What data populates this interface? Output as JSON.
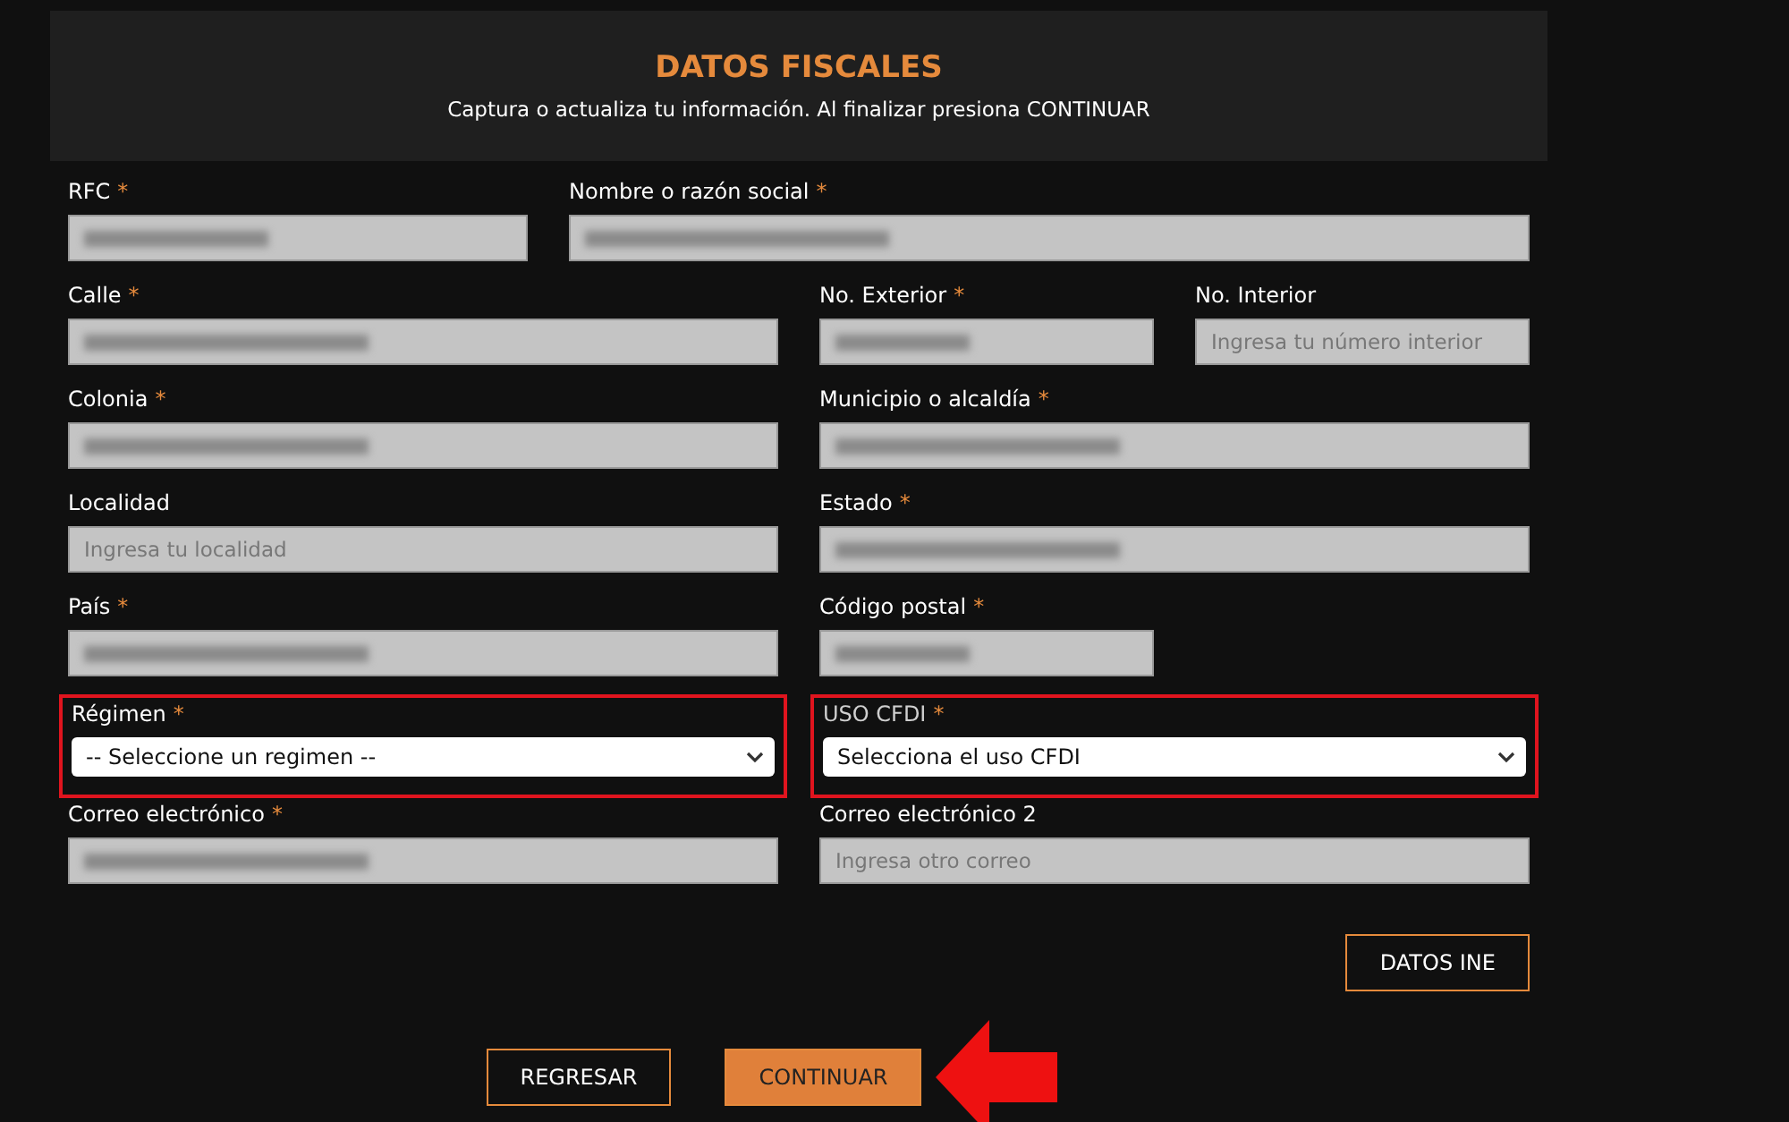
{
  "header": {
    "title": "DATOS FISCALES",
    "subtitle": "Captura o actualiza tu información. Al finalizar presiona CONTINUAR"
  },
  "rows": [
    [
      {
        "kind": "input",
        "label": "RFC",
        "required_mark": "*",
        "redacted": true
      },
      {
        "kind": "input",
        "label": "Nombre o razón social",
        "required_mark": "*",
        "redacted": true
      }
    ],
    [
      {
        "kind": "input",
        "label": "Calle",
        "required_mark": "*",
        "redacted": true
      },
      {
        "kind": "input",
        "label": "No. Exterior",
        "required_mark": "*",
        "redacted": true
      },
      {
        "kind": "input",
        "label": "No. Interior",
        "placeholder": "Ingresa tu número interior"
      }
    ],
    [
      {
        "kind": "input",
        "label": "Colonia",
        "required_mark": "*",
        "redacted": true
      },
      {
        "kind": "input",
        "label": "Municipio o alcaldía",
        "required_mark": "*",
        "redacted": true
      }
    ],
    [
      {
        "kind": "input",
        "label": "Localidad",
        "placeholder": "Ingresa tu localidad"
      },
      {
        "kind": "input",
        "label": "Estado",
        "required_mark": "*",
        "redacted": true
      }
    ],
    [
      {
        "kind": "input",
        "label": "País",
        "required_mark": "*",
        "redacted": true
      },
      {
        "kind": "input",
        "label": "Código postal",
        "required_mark": "*",
        "redacted": true
      }
    ],
    [
      {
        "kind": "select",
        "label": "Régimen",
        "required_mark": "*",
        "value": "-- Seleccione un regimen --",
        "highlighted": true
      },
      {
        "kind": "select",
        "label": "USO CFDI",
        "required_mark": "*",
        "value": "Selecciona el uso CFDI",
        "highlighted": true
      }
    ],
    [
      {
        "kind": "input",
        "label": "Correo electrónico",
        "required_mark": "*",
        "redacted": true
      },
      {
        "kind": "input",
        "label": "Correo electrónico 2",
        "placeholder": "Ingresa otro correo"
      }
    ]
  ],
  "side_button": "DATOS INE",
  "buttons": [
    {
      "label": "REGRESAR",
      "primary": false
    },
    {
      "label": "CONTINUAR",
      "primary": true,
      "pointed_at": true
    }
  ]
}
